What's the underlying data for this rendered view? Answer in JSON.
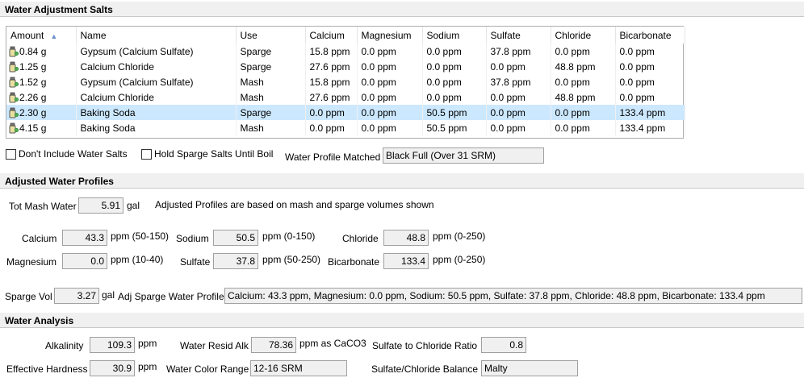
{
  "salts_section": {
    "title": "Water Adjustment Salts"
  },
  "grid": {
    "columns": [
      "Amount",
      "Name",
      "Use",
      "Calcium",
      "Magnesium",
      "Sodium",
      "Sulfate",
      "Chloride",
      "Bicarbonate"
    ],
    "rows": [
      [
        "0.84 g",
        "Gypsum (Calcium Sulfate)",
        "Sparge",
        "15.8 ppm",
        "0.0 ppm",
        "0.0 ppm",
        "37.8 ppm",
        "0.0 ppm",
        "0.0 ppm"
      ],
      [
        "1.25 g",
        "Calcium Chloride",
        "Sparge",
        "27.6 ppm",
        "0.0 ppm",
        "0.0 ppm",
        "0.0 ppm",
        "48.8 ppm",
        "0.0 ppm"
      ],
      [
        "1.52 g",
        "Gypsum (Calcium Sulfate)",
        "Mash",
        "15.8 ppm",
        "0.0 ppm",
        "0.0 ppm",
        "37.8 ppm",
        "0.0 ppm",
        "0.0 ppm"
      ],
      [
        "2.26 g",
        "Calcium Chloride",
        "Mash",
        "27.6 ppm",
        "0.0 ppm",
        "0.0 ppm",
        "0.0 ppm",
        "48.8 ppm",
        "0.0 ppm"
      ],
      [
        "2.30 g",
        "Baking Soda",
        "Sparge",
        "0.0 ppm",
        "0.0 ppm",
        "50.5 ppm",
        "0.0 ppm",
        "0.0 ppm",
        "133.4 ppm"
      ],
      [
        "4.15 g",
        "Baking Soda",
        "Mash",
        "0.0 ppm",
        "0.0 ppm",
        "50.5 ppm",
        "0.0 ppm",
        "0.0 ppm",
        "133.4 ppm"
      ]
    ],
    "selected_row": 4
  },
  "options": {
    "dont_include_label": "Don't Include Water Salts",
    "hold_sparge_label": "Hold Sparge Salts Until Boil",
    "profile_matched_label": "Water Profile Matched",
    "profile_matched_value": "Black Full (Over 31 SRM)"
  },
  "adjusted_section": {
    "title": "Adjusted Water Profiles",
    "tot_mash_label": "Tot Mash Water",
    "tot_mash_value": "5.91",
    "tot_mash_unit": "gal",
    "note": "Adjusted Profiles are based on mash and sparge volumes shown",
    "calcium_label": "Calcium",
    "calcium_value": "43.3",
    "calcium_range": "ppm (50-150)",
    "magnesium_label": "Magnesium",
    "magnesium_value": "0.0",
    "magnesium_range": "ppm (10-40)",
    "sodium_label": "Sodium",
    "sodium_value": "50.5",
    "sodium_range": "ppm (0-150)",
    "sulfate_label": "Sulfate",
    "sulfate_value": "37.8",
    "sulfate_range": "ppm (50-250)",
    "chloride_label": "Chloride",
    "chloride_value": "48.8",
    "chloride_range": "ppm (0-250)",
    "bicarbonate_label": "Bicarbonate",
    "bicarbonate_value": "133.4",
    "bicarbonate_range": "ppm (0-250)",
    "sparge_vol_label": "Sparge Vol",
    "sparge_vol_value": "3.27",
    "sparge_vol_unit": "gal",
    "sparge_profile_label": "Adj Sparge Water Profile",
    "sparge_profile_value": "Calcium: 43.3 ppm, Magnesium: 0.0 ppm, Sodium: 50.5 ppm, Sulfate: 37.8 ppm, Chloride: 48.8 ppm, Bicarbonate: 133.4 ppm"
  },
  "analysis_section": {
    "title": "Water Analysis",
    "alkalinity_label": "Alkalinity",
    "alkalinity_value": "109.3",
    "alkalinity_unit": "ppm",
    "resid_alk_label": "Water Resid Alk",
    "resid_alk_value": "78.36",
    "resid_alk_unit": "ppm as CaCO3",
    "ratio_label": "Sulfate to Chloride Ratio",
    "ratio_value": "0.8",
    "hardness_label": "Effective Hardness",
    "hardness_value": "30.9",
    "hardness_unit": "ppm",
    "color_range_label": "Water Color Range",
    "color_range_value": "12-16 SRM",
    "balance_label": "Sulfate/Chloride Balance",
    "balance_value": "Malty"
  }
}
